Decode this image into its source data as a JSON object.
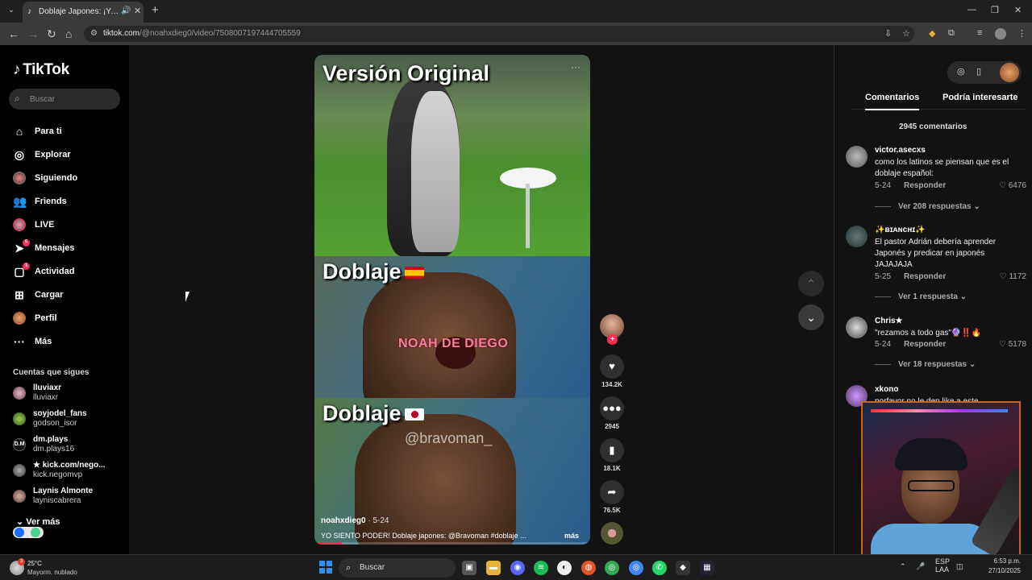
{
  "browser": {
    "tab_title": "Doblaje Japones: ¡Yo Siento...",
    "url_domain": "tiktok.com",
    "url_path": "/@noahxdieg0/video/7508007197444705559"
  },
  "sidebar": {
    "logo": "TikTok",
    "search_placeholder": "Buscar",
    "nav": [
      {
        "label": "Para ti",
        "icon": "home-icon"
      },
      {
        "label": "Explorar",
        "icon": "compass-icon"
      },
      {
        "label": "Siguiendo",
        "icon": "following-avatar-icon"
      },
      {
        "label": "Friends",
        "icon": "friends-icon"
      },
      {
        "label": "LIVE",
        "icon": "live-icon"
      },
      {
        "label": "Mensajes",
        "icon": "messages-icon",
        "badge": "5"
      },
      {
        "label": "Actividad",
        "icon": "activity-icon",
        "badge": "1"
      },
      {
        "label": "Cargar",
        "icon": "upload-icon"
      },
      {
        "label": "Perfil",
        "icon": "profile-avatar"
      },
      {
        "label": "Más",
        "icon": "more-icon"
      }
    ],
    "following_title": "Cuentas que sigues",
    "following": [
      {
        "name": "lluviaxr",
        "user": "lluviaxr"
      },
      {
        "name": "soyjodel_fans",
        "user": "godson_isor"
      },
      {
        "name": "dm.plays",
        "user": "dm.plays16"
      },
      {
        "name": "★ kick.com/nego...",
        "user": "kick.negomvp"
      },
      {
        "name": "Laynis Almonte",
        "user": "layniscabrera"
      }
    ],
    "see_more": "Ver más"
  },
  "video": {
    "panel1_title": "Versión Original",
    "panel2_title": "Doblaje",
    "panel3_title": "Doblaje",
    "watermark1": "NOAH DE DIEGO",
    "watermark2": "@bravoman_",
    "author": "noahxdieg0",
    "date": "5-24",
    "caption": "YO SIENTO PODER! Doblaje japones: @Bravoman  #doblaje ...",
    "more": "más",
    "progress_fraction": 0.1
  },
  "actions": {
    "likes": "134.2K",
    "comments": "2945",
    "saves": "18.1K",
    "shares": "76.5K"
  },
  "comments_panel": {
    "tab_comments": "Comentarios",
    "tab_interest": "Podría interesarte",
    "count_label": "2945 comentarios",
    "reply_label": "Responder",
    "items": [
      {
        "user": "victor.asecxs",
        "text": "como los latinos se piensan que es el doblaje español:",
        "date": "5-24",
        "likes": "6476",
        "replies": "Ver 208 respuestas"
      },
      {
        "user": "✨ʙɪᴀɴᴄʜɪ✨",
        "text": "El pastor Adrián debería aprender Japonés y predicar en japonés JAJAJAJA",
        "date": "5-25",
        "likes": "1172",
        "replies": "Ver 1 respuesta"
      },
      {
        "user": "Chris★",
        "text": "\"rezamos a todo gas\"🔮‼️🔥",
        "date": "5-24",
        "likes": "5178",
        "replies": "Ver 18 respuestas"
      },
      {
        "user": "xkono",
        "text": "porfavor no le den like a este",
        "date": "",
        "likes": "",
        "replies": ""
      }
    ]
  },
  "taskbar": {
    "temp": "25°C",
    "weather": "Mayorm. nublado",
    "weather_badge": "3",
    "search": "Buscar",
    "lang": "ESP",
    "lang_sub": "LAA",
    "time": "6:53 p.m.",
    "date": "27/10/2025"
  },
  "colors": {
    "accent": "#fe2c55",
    "background": "#000000",
    "panel": "#121212"
  }
}
